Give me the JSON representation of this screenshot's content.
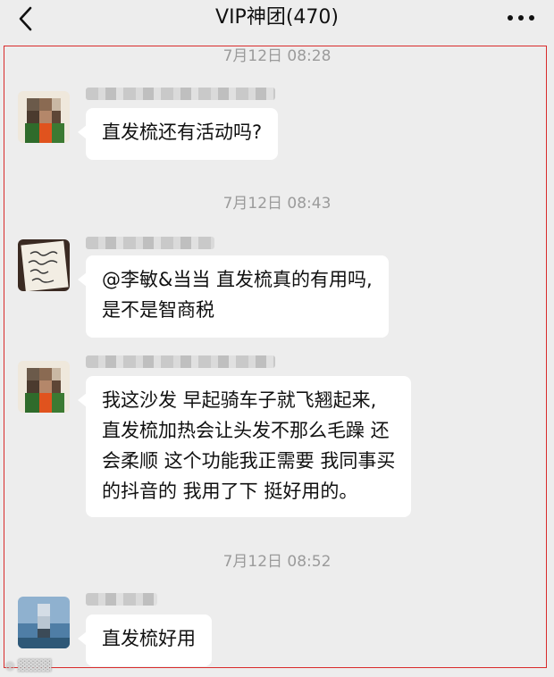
{
  "header": {
    "title": "VIP神团(470)",
    "back_icon": "chevron-left-icon",
    "more_icon": "more-dots-icon"
  },
  "messages": [
    {
      "timestamp": "7月12日 08:28",
      "lines": [
        "直发梳还有活动吗?"
      ]
    },
    {
      "timestamp": "7月12日 08:43",
      "lines": [
        "@李敏&当当 直发梳真的有用吗,",
        "是不是智商税"
      ]
    },
    {
      "timestamp": "",
      "lines": [
        "我这沙发 早起骑车子就飞翘起来,",
        "直发梳加热会让头发不那么毛躁 还",
        "会柔顺 这个功能我正需要 我同事买",
        "的抖音的 我用了下 挺好用的。"
      ]
    },
    {
      "timestamp": "7月12日 08:52",
      "lines": [
        "直发梳好用"
      ]
    }
  ],
  "colors": {
    "background": "#ededed",
    "bubble": "#ffffff",
    "frame": "#d92b2b",
    "timestamp": "#9b9b9b"
  }
}
